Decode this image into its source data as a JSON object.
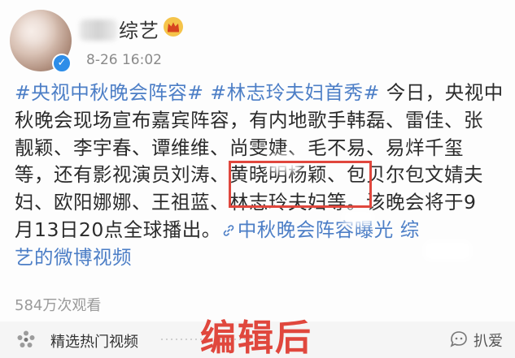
{
  "header": {
    "account_name": "综艺",
    "timestamp": "8-26 16:02"
  },
  "post": {
    "lines": [
      {
        "segments": [
          {
            "text": "#央视中秋晚会阵容#",
            "style": "hashtag"
          },
          {
            "text": " ",
            "style": "plain"
          },
          {
            "text": "#林志玲夫妇首秀#",
            "style": "hashtag"
          },
          {
            "text": " 今日，央视中",
            "style": "plain"
          }
        ]
      },
      {
        "segments": [
          {
            "text": "秋晚会现场宣布嘉宾阵容，有内地歌手韩磊、雷佳、张",
            "style": "plain"
          }
        ]
      },
      {
        "segments": [
          {
            "text": "靓颖、李宇春、谭维维、尚雯婕、毛不易、易烊千玺",
            "style": "plain"
          }
        ]
      },
      {
        "segments": [
          {
            "text": "等，还有影视演员刘涛、黄晓明杨颖、包贝尔包文婧夫",
            "style": "plain"
          }
        ]
      },
      {
        "segments": [
          {
            "text": "妇、欧阳娜娜、王祖蓝、林志玲夫妇等。该晚会将于9",
            "style": "plain"
          }
        ]
      },
      {
        "segments": [
          {
            "text": "月13日20点全球播出。",
            "style": "plain"
          },
          {
            "text": "中秋晚会阵容曝光",
            "style": "link"
          },
          {
            "text": "      综",
            "style": "link"
          }
        ]
      },
      {
        "segments": [
          {
            "text": "艺的微博视频",
            "style": "link"
          }
        ]
      }
    ],
    "view_count": "584万次观看"
  },
  "bottom_bar": {
    "featured_video": "精选热门视频",
    "edit_label": "编辑后",
    "brand_name": "扒爱"
  },
  "colors": {
    "hashtag": "#4c7ec6",
    "highlight": "#e0473d",
    "verified": "#2e8de8"
  },
  "icons": [
    "verified-icon",
    "crown-icon",
    "link-icon",
    "flower-icon",
    "brand-icon"
  ]
}
